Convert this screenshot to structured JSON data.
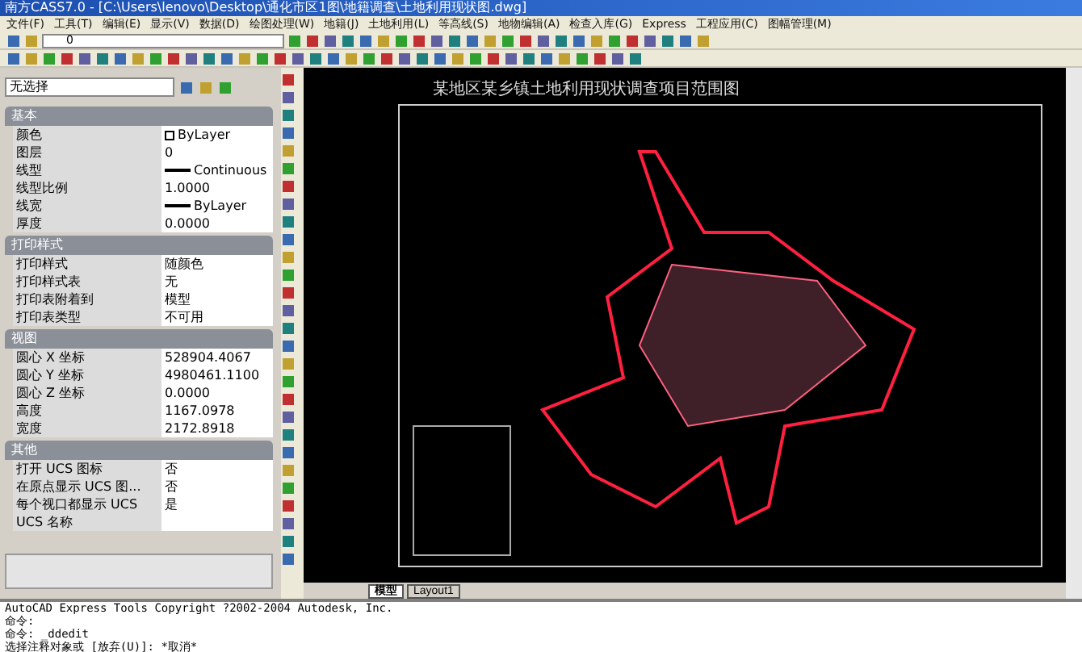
{
  "window": {
    "title": "南方CASS7.0 - [C:\\Users\\lenovo\\Desktop\\通化市区1图\\地籍调查\\土地利用现状图.dwg]"
  },
  "menu": [
    "文件(F)",
    "工具(T)",
    "编辑(E)",
    "显示(V)",
    "数据(D)",
    "绘图处理(W)",
    "地籍(J)",
    "土地利用(L)",
    "等高线(S)",
    "地物编辑(A)",
    "检查入库(G)",
    "Express",
    "工程应用(C)",
    "图幅管理(M)"
  ],
  "layer_field": {
    "value": "0"
  },
  "properties": {
    "selection": "无选择",
    "sections": [
      {
        "title": "基本",
        "rows": [
          {
            "kind": "color",
            "label": "颜色",
            "value": "ByLayer"
          },
          {
            "kind": "text",
            "label": "图层",
            "value": "0"
          },
          {
            "kind": "linetype",
            "label": "线型",
            "value": "Continuous"
          },
          {
            "kind": "text",
            "label": "线型比例",
            "value": "1.0000"
          },
          {
            "kind": "linetype",
            "label": "线宽",
            "value": "ByLayer"
          },
          {
            "kind": "text",
            "label": "厚度",
            "value": "0.0000"
          }
        ]
      },
      {
        "title": "打印样式",
        "rows": [
          {
            "kind": "text",
            "label": "打印样式",
            "value": "随颜色"
          },
          {
            "kind": "text",
            "label": "打印样式表",
            "value": "无"
          },
          {
            "kind": "text",
            "label": "打印表附着到",
            "value": "模型"
          },
          {
            "kind": "text",
            "label": "打印表类型",
            "value": "不可用"
          }
        ]
      },
      {
        "title": "视图",
        "rows": [
          {
            "kind": "text",
            "label": "圆心 X 坐标",
            "value": "528904.4067"
          },
          {
            "kind": "text",
            "label": "圆心 Y 坐标",
            "value": "4980461.1100"
          },
          {
            "kind": "text",
            "label": "圆心 Z 坐标",
            "value": "0.0000"
          },
          {
            "kind": "text",
            "label": "高度",
            "value": "1167.0978"
          },
          {
            "kind": "text",
            "label": "宽度",
            "value": "2172.8918"
          }
        ]
      },
      {
        "title": "其他",
        "rows": [
          {
            "kind": "text",
            "label": "打开 UCS 图标",
            "value": "否"
          },
          {
            "kind": "text",
            "label": "在原点显示 UCS 图...",
            "value": "否"
          },
          {
            "kind": "text",
            "label": "每个视口都显示 UCS",
            "value": "是"
          },
          {
            "kind": "text",
            "label": "UCS 名称",
            "value": ""
          }
        ]
      }
    ]
  },
  "drawing": {
    "title": "某地区某乡镇土地利用现状调查项目范围图"
  },
  "layout_tabs": [
    {
      "label": "模型",
      "selected": true
    },
    {
      "label": "Layout1",
      "selected": false
    }
  ],
  "command_lines": [
    "AutoCAD Express Tools Copyright ?2002-2004 Autodesk, Inc.",
    "命令:",
    "命令: _ddedit",
    "选择注释对象或 [放弃(U)]: *取消*"
  ]
}
